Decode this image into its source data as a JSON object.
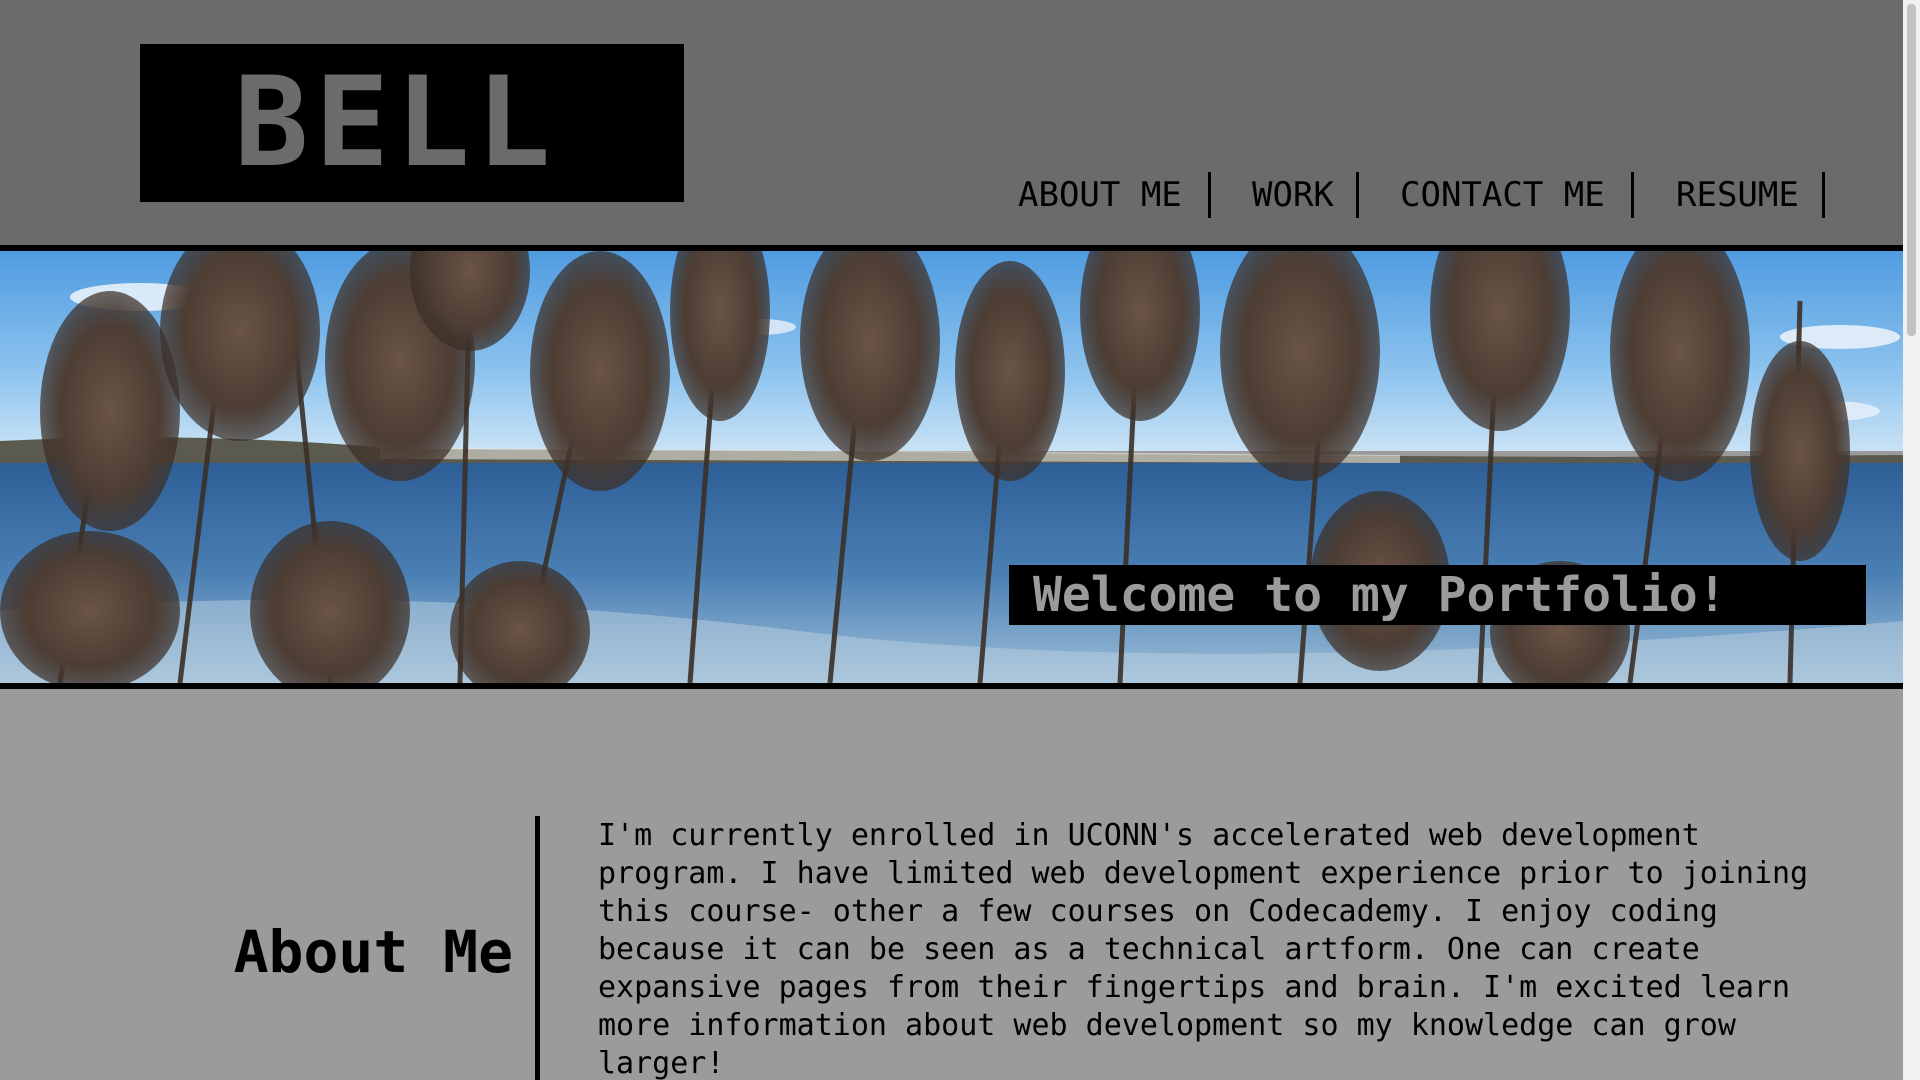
{
  "header": {
    "logo_text": "BELL",
    "nav": [
      {
        "label": "ABOUT ME"
      },
      {
        "label": "WORK"
      },
      {
        "label": "CONTACT ME"
      },
      {
        "label": "RESUME"
      }
    ]
  },
  "hero": {
    "banner_text": "Welcome to my Portfolio!",
    "image_description_icon": "landscape-photo"
  },
  "about": {
    "heading": "About Me",
    "body": "I'm currently enrolled in UCONN's accelerated web development program. I have limited web development experience prior to joining this course- other a few courses on Codecademy. I enjoy coding because it can be seen as a technical artform. One can create expansive pages from their fingertips and brain. I'm excited learn more information about web development so my knowledge can grow larger!"
  },
  "colors": {
    "header_bg": "#6b6b6d",
    "page_bg": "#9b9b9b",
    "logo_bg": "#000000",
    "banner_bg": "#000000"
  }
}
